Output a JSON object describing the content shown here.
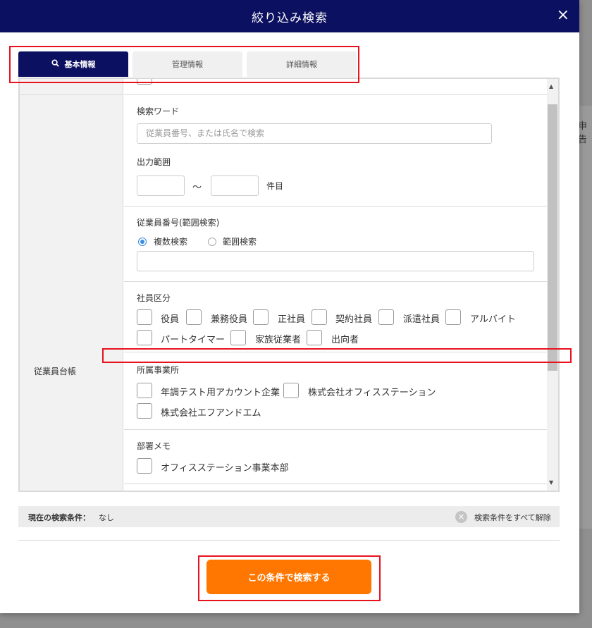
{
  "modal": {
    "title": "絞り込み検索",
    "close_glyph": "×"
  },
  "tabs": [
    {
      "label": "基本情報",
      "icon": "search-icon",
      "active": true
    },
    {
      "label": "管理情報",
      "active": false
    },
    {
      "label": "詳細情報",
      "active": false
    }
  ],
  "row_label": "従業員台帳",
  "search_word": {
    "title": "検索ワード",
    "placeholder": "従業員番号、または氏名で検索"
  },
  "output_range": {
    "title": "出力範囲",
    "tilde": "～",
    "unit": "件目"
  },
  "employee_number": {
    "title": "従業員番号(範囲検索)",
    "options": [
      "複数検索",
      "範囲検索"
    ],
    "selected": "複数検索"
  },
  "employee_type": {
    "title": "社員区分",
    "options": [
      "役員",
      "兼務役員",
      "正社員",
      "契約社員",
      "派遣社員",
      "アルバイト",
      "パートタイマー",
      "家族従業者",
      "出向者"
    ]
  },
  "office": {
    "title": "所属事業所",
    "options": [
      "年調テスト用アカウント企業",
      "株式会社オフィスステーション",
      "株式会社エフアンドエム"
    ]
  },
  "dept_memo": {
    "title": "部署メモ",
    "options": [
      "オフィスステーション事業本部"
    ]
  },
  "condition": {
    "label": "現在の検索条件：",
    "value": "なし",
    "clear_label": "検索条件をすべて解除"
  },
  "search_button": {
    "label": "この条件で検索する"
  },
  "backdrop": {
    "partial_text": "申告"
  },
  "colors": {
    "header": "#0c1060",
    "accent": "#ff7700",
    "highlight": "#e8121e"
  }
}
